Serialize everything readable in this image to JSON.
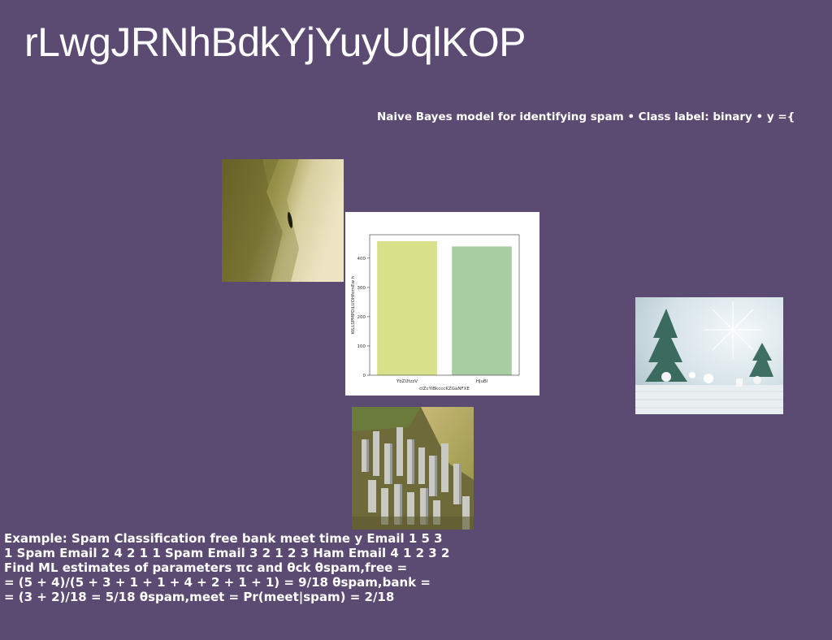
{
  "header": {
    "title": "rLwgJRNhBdkYjYuyUqlKOP",
    "subtitle": "Naive Bayes model for identifying spam • Class label: binary • y ={"
  },
  "body": {
    "lines": [
      "Example: Spam Classification free bank meet time y Email 1 5 3",
      "1 Spam Email 2 4 2 1 1 Spam Email 3 2 1 2 3 Ham Email 4 1 2 3 2",
      "Find ML estimates of parameters πc and θck θspam,free =",
      "= (5 + 4)/(5 + 3 + 1 + 1 + 4 + 2 + 1 + 1) = 9/18 θspam,bank =",
      "= (3 + 2)/18 = 5/18 θspam,meet = Pr(meet|spam) = 2/18"
    ]
  },
  "images": {
    "sepia_photo": "sepia aerial photo",
    "city_photo": "aerial city skyline photo",
    "tree_photo": "winter decorative trees photo"
  },
  "chart_data": {
    "type": "bar",
    "categories": [
      "YbZUtzzV",
      "HJuBl"
    ],
    "values": [
      458,
      440
    ],
    "xlabel": "cIZcYiBkcccKZGaNFXE",
    "ylabel": "WLLSPMPDiLUOHfornEw h",
    "ylim": [
      0,
      480
    ],
    "yticks": [
      0,
      100,
      200,
      300,
      400
    ],
    "colors": [
      "#d9e08a",
      "#a9cda3"
    ],
    "grid": false
  }
}
